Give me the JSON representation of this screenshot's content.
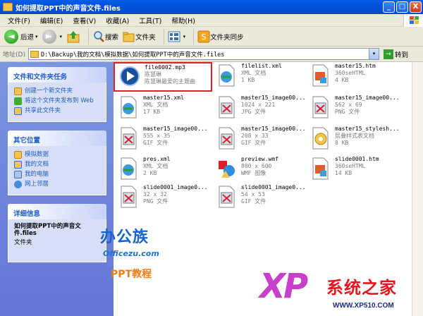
{
  "window": {
    "title": "如何提取PPT中的声音文件.files",
    "buttons": [
      "_",
      "□",
      "X"
    ]
  },
  "menu": [
    "文件(F)",
    "编辑(E)",
    "查看(V)",
    "收藏(A)",
    "工具(T)",
    "帮助(H)"
  ],
  "toolbar": {
    "back": "后退",
    "back_glyph": "◄",
    "forward_glyph": "►",
    "search": "搜索",
    "folders": "文件夹",
    "sync": "文件夹同步",
    "dropdown": "▾"
  },
  "address": {
    "label": "地址(D)",
    "path": "D:\\Backup\\我的文档\\模拟数据\\如何提取PPT中的声音文件.files",
    "go_glyph": "→",
    "go": "转到"
  },
  "tasks": {
    "file_tasks_title": "文件和文件夹任务",
    "file_tasks": [
      "创建一个新文件夹",
      "将这个文件夹发布到 Web",
      "共享此文件夹"
    ],
    "other_title": "其它位置",
    "other": [
      "模拟数据",
      "我的文档",
      "我的电脑",
      "网上邻居"
    ],
    "details_title": "详细信息",
    "details_name": "如何提取PPT中的声音文件.files",
    "details_type": "文件夹"
  },
  "files": [
    {
      "name": "file0002.mp3",
      "l2": "陈慧琳",
      "l3": "陈慧琳最爱的主题曲",
      "icon": "media-player-icon"
    },
    {
      "name": "filelist.xml",
      "l2": "XML 文档",
      "l3": "1 KB",
      "icon": "xml-icon"
    },
    {
      "name": "master15.htm",
      "l2": "360seHTML",
      "l3": "4 KB",
      "icon": "htm-icon"
    },
    {
      "name": "master15.xml",
      "l2": "XML 文档",
      "l3": "17 KB",
      "icon": "xml-icon"
    },
    {
      "name": "master15_image00...",
      "l2": "1024 x 221",
      "l3": "JPG 文件",
      "icon": "image-icon"
    },
    {
      "name": "master15_image00...",
      "l2": "562 x 69",
      "l3": "PNG 文件",
      "icon": "image-icon"
    },
    {
      "name": "master15_image00...",
      "l2": "555 x 35",
      "l3": "GIF 文件",
      "icon": "image-icon"
    },
    {
      "name": "master15_image00...",
      "l2": "208 x 33",
      "l3": "GIF 文件",
      "icon": "image-icon"
    },
    {
      "name": "master15_stylesh...",
      "l2": "层叠样式表文档",
      "l3": "8 KB",
      "icon": "css-icon"
    },
    {
      "name": "pres.xml",
      "l2": "XML 文档",
      "l3": "2 KB",
      "icon": "xml-icon"
    },
    {
      "name": "preview.wmf",
      "l2": "800 x 600",
      "l3": "WMF 图像",
      "icon": "wmf-icon"
    },
    {
      "name": "slide0001.htm",
      "l2": "360seHTML",
      "l3": "14 KB",
      "icon": "htm-icon"
    },
    {
      "name": "slide0001_image0...",
      "l2": "32 x 32",
      "l3": "PNG 文件",
      "icon": "image-icon"
    },
    {
      "name": "slide0001_image0...",
      "l2": "54 x 53",
      "l3": "GIF 文件",
      "icon": "image-icon"
    }
  ],
  "watermark": {
    "cn_logo": "办公族",
    "cn_url": "Officezu.com",
    "cn_sub": "PPT教程",
    "xp": "XP",
    "xp_name": "系统之家",
    "xp_url": "WWW.XP510.COM"
  },
  "colors": {
    "selection": "#d8222a",
    "link": "#215dc6",
    "pane": "#6b7fd9"
  }
}
